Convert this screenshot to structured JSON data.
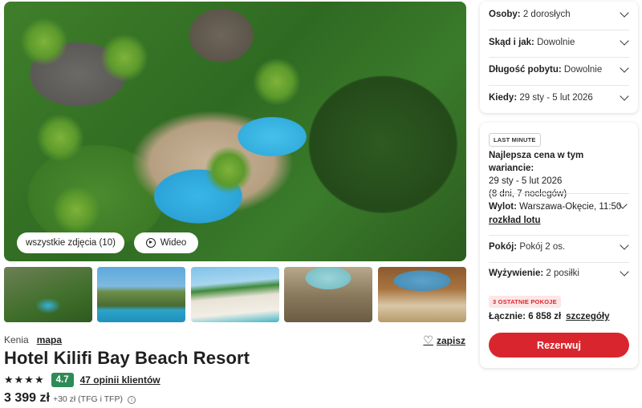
{
  "gallery": {
    "all_photos_label": "wszystkie zdjęcia (10)",
    "video_label": "Wideo"
  },
  "hotel": {
    "country": "Kenia",
    "map_link": "mapa",
    "save_label": "zapisz",
    "name": "Hotel Kilifi Bay Beach Resort",
    "stars": "★★★★",
    "star_count": 4,
    "score": "4.7",
    "reviews": "47 opinii klientów",
    "price": "3 399 zł",
    "price_extra": "+30 zł (TFG i TFP)"
  },
  "filters": {
    "persons_label": "Osoby:",
    "persons_value": "2 dorosłych",
    "from_label": "Skąd i jak:",
    "from_value": "Dowolnie",
    "length_label": "Długość pobytu:",
    "length_value": "Dowolnie",
    "when_label": "Kiedy:",
    "when_value": "29 sty - 5 lut 2026"
  },
  "offer": {
    "badge": "LAST MINUTE",
    "best_price_title": "Najlepsza cena w tym wariancie:",
    "dates": "29 sty - 5 lut 2026",
    "duration": "(8 dni, 7 noclegów)",
    "departure_label": "Wylot:",
    "departure_value": "Warszawa-Okęcie, 11:50",
    "flight_schedule_link": "rozkład lotu",
    "room_label": "Pokój:",
    "room_value": "Pokój 2 os.",
    "board_label": "Wyżywienie:",
    "board_value": "2 posiłki",
    "last_rooms_badge": "3 OSTATNIE POKOJE",
    "total_label": "Łącznie:",
    "total_value": "6 858 zł",
    "details_link": "szczegóły",
    "reserve_label": "Rezerwuj"
  },
  "colors": {
    "accent_red": "#d9262e",
    "score_green": "#2e8b57"
  }
}
